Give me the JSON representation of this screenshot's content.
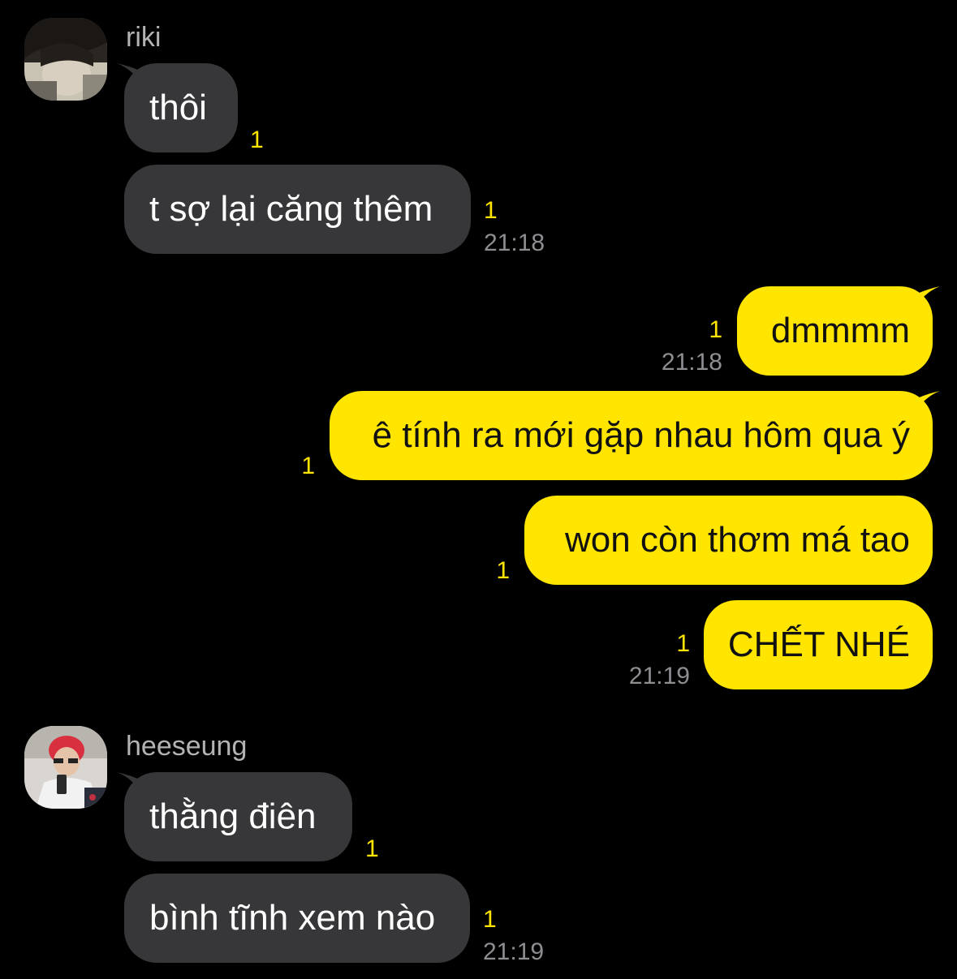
{
  "colors": {
    "background": "#000000",
    "incoming_bubble": "#37373a",
    "outgoing_bubble": "#ffe500",
    "unread_count": "#ffe500",
    "timestamp": "#8e8e92",
    "sender_name": "#b3b3b3"
  },
  "chat": {
    "group1": {
      "sender": "riki",
      "messages": [
        {
          "text": "thôi",
          "unread": "1"
        },
        {
          "text": "t sợ lại căng thêm",
          "unread": "1",
          "time": "21:18"
        }
      ]
    },
    "group2": {
      "messages": [
        {
          "text": "dmmmm",
          "unread": "1",
          "time": "21:18"
        },
        {
          "text": "ê tính ra mới gặp nhau hôm qua ý",
          "unread": "1"
        },
        {
          "text": "won còn thơm má tao",
          "unread": "1"
        },
        {
          "text": "CHẾT NHÉ",
          "unread": "1",
          "time": "21:19"
        }
      ]
    },
    "group3": {
      "sender": "heeseung",
      "messages": [
        {
          "text": "thằng điên",
          "unread": "1"
        },
        {
          "text": "bình tĩnh xem nào",
          "unread": "1",
          "time": "21:19"
        }
      ]
    }
  }
}
